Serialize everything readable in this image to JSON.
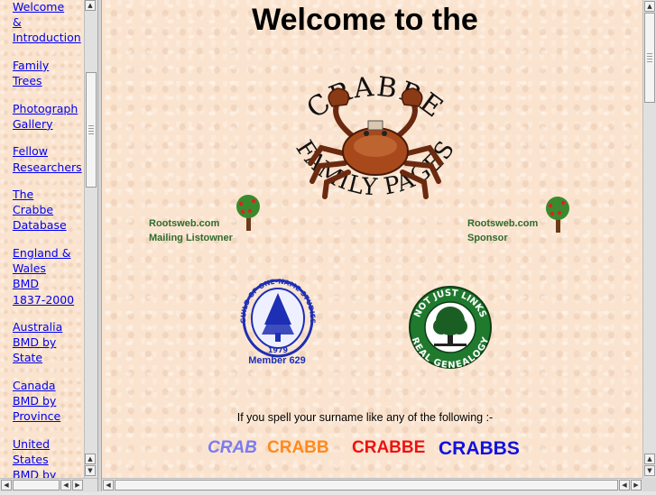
{
  "nav": {
    "items": [
      {
        "label": "Welcome\n&\nIntroduction"
      },
      {
        "label": "Family\nTrees"
      },
      {
        "label": "Photograph\nGallery"
      },
      {
        "label": "Fellow\nResearchers"
      },
      {
        "label": "The\nCrabbe\nDatabase"
      },
      {
        "label": "England &\nWales\nBMD\n1837-2000"
      },
      {
        "label": "Australia\nBMD by\nState"
      },
      {
        "label": "Canada\nBMD by\nProvince"
      },
      {
        "label": "United\nStates\nBMD by"
      }
    ]
  },
  "main": {
    "title": "Welcome to the",
    "logo": {
      "top_text": "CRABBE",
      "bottom_text": "FAMILY PAGES"
    },
    "rootsweb_left": {
      "line1": "Rootsweb.com",
      "line2": "Mailing Listowner"
    },
    "rootsweb_right": {
      "line1": "Rootsweb.com",
      "line2": "Sponsor"
    },
    "guild": {
      "ring_text": "GUILD OF ONE-NAME STUDIES",
      "year": "1979",
      "member": "Member 629"
    },
    "njl": {
      "top_text": "NOT JUST LINKS",
      "bottom_text": "REAL GENEALOGY"
    },
    "spell_intro": "If you spell your surname like any of the following :-",
    "variants": [
      {
        "text": "CRAB",
        "color": "#7b7bf0"
      },
      {
        "text": "CRABB",
        "color": "#ff8a1c"
      },
      {
        "text": "CRABBE",
        "color": "#ee1111"
      },
      {
        "text": "CRABBS",
        "color": "#1111dd"
      }
    ]
  },
  "colors": {
    "background": "#fbe4cf",
    "link": "#0000ee",
    "rootsweb_green": "#2e6b2e",
    "guild_blue": "#1d2fb4",
    "njl_green": "#1f7a2e"
  }
}
